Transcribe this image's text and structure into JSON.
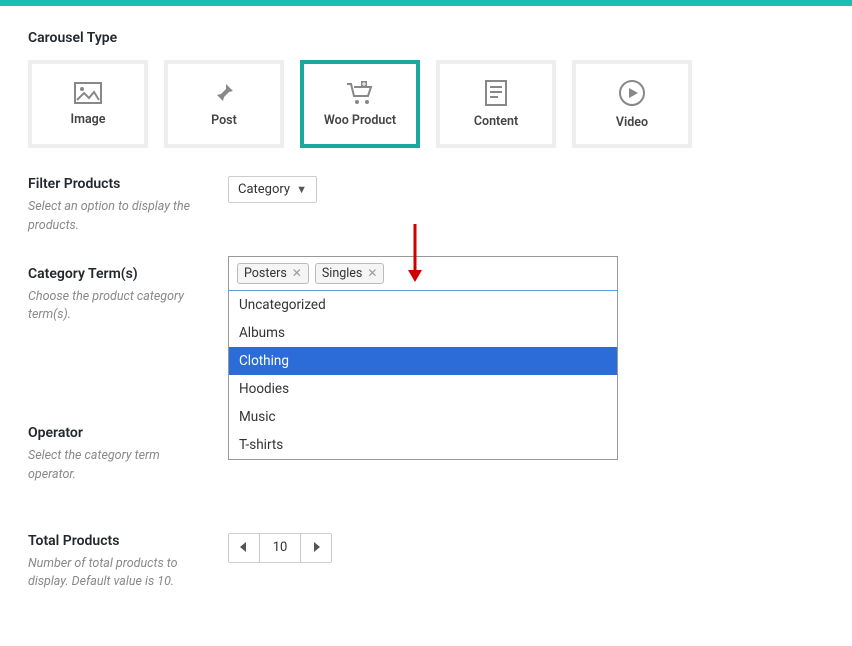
{
  "section_title": "Carousel Type",
  "types": [
    {
      "label": "Image"
    },
    {
      "label": "Post"
    },
    {
      "label": "Woo Product"
    },
    {
      "label": "Content"
    },
    {
      "label": "Video"
    }
  ],
  "filter": {
    "label": "Filter Products",
    "help": "Select an option to display the products.",
    "value": "Category"
  },
  "category": {
    "label": "Category Term(s)",
    "help": "Choose the product category term(s).",
    "selected_tags": [
      "Posters",
      "Singles"
    ],
    "options": [
      "Uncategorized",
      "Albums",
      "Clothing",
      "Hoodies",
      "Music",
      "T-shirts"
    ],
    "highlighted_index": 2
  },
  "operator": {
    "label": "Operator",
    "help": "Select the category term operator."
  },
  "total": {
    "label": "Total Products",
    "help": "Number of total products to display. Default value is 10.",
    "value": "10"
  }
}
